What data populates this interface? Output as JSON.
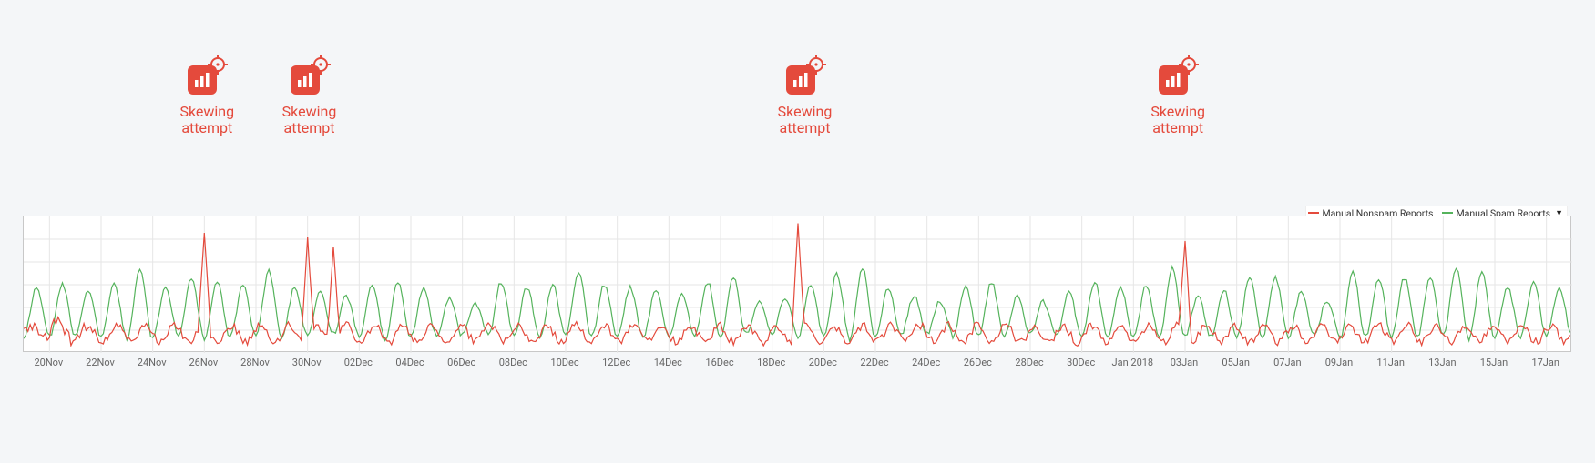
{
  "chart_data": {
    "type": "line",
    "title": "",
    "xlabel": "",
    "ylabel": "",
    "x_ticks": [
      "20Nov",
      "22Nov",
      "24Nov",
      "26Nov",
      "28Nov",
      "30Nov",
      "02Dec",
      "04Dec",
      "06Dec",
      "08Dec",
      "10Dec",
      "12Dec",
      "14Dec",
      "16Dec",
      "18Dec",
      "20Dec",
      "22Dec",
      "24Dec",
      "26Dec",
      "28Dec",
      "30Dec",
      "Jan 2018",
      "03Jan",
      "05Jan",
      "07Jan",
      "09Jan",
      "11Jan",
      "13Jan",
      "15Jan",
      "17Jan"
    ],
    "date_range": [
      "2017-11-19",
      "2018-01-18"
    ],
    "ylim_note": "relative units — y-axis not labeled in figure; values below are estimated from pixel heights (0–100)",
    "series": [
      {
        "name": "Manual Spam Reports",
        "color": "#55b35c",
        "pattern": "daily cycle, roughly one peak per day ranging ~30–65, troughs ~5–15",
        "sample_values_per_day_peak": [
          48,
          50,
          45,
          50,
          61,
          48,
          55,
          52,
          50,
          60,
          48,
          45,
          42,
          50,
          52,
          48,
          40,
          36,
          52,
          48,
          50,
          60,
          50,
          48,
          46,
          44,
          52,
          55,
          38,
          40,
          50,
          58,
          62,
          48,
          42,
          38,
          48,
          52,
          42,
          38,
          45,
          52,
          48,
          50,
          62,
          42,
          46,
          55,
          55,
          45,
          38,
          60,
          55,
          55,
          55,
          62,
          60,
          48,
          52,
          48
        ],
        "sample_values_per_day_trough": [
          12,
          12,
          12,
          12,
          10,
          12,
          12,
          10,
          12,
          12,
          12,
          12,
          14,
          12,
          10,
          12,
          12,
          14,
          12,
          12,
          12,
          12,
          12,
          12,
          12,
          12,
          12,
          12,
          14,
          14,
          12,
          12,
          10,
          12,
          14,
          14,
          12,
          12,
          12,
          14,
          12,
          12,
          12,
          12,
          10,
          12,
          12,
          12,
          12,
          12,
          14,
          10,
          12,
          12,
          12,
          12,
          10,
          12,
          12,
          12
        ]
      },
      {
        "name": "Manual Nonspam Reports",
        "color": "#e44a3c",
        "pattern": "mostly 10–25 with noise; sharp isolated spikes at the four skewing-attempt dates reaching ~80–95",
        "baseline_range": [
          8,
          28
        ],
        "spikes": [
          {
            "date": "2017-11-26",
            "approx_value": 88
          },
          {
            "date": "2017-11-30",
            "approx_value": 85
          },
          {
            "date": "2017-12-01",
            "approx_value": 78
          },
          {
            "date": "2017-12-19",
            "approx_value": 95
          },
          {
            "date": "2018-01-03",
            "approx_value": 82
          }
        ]
      }
    ],
    "legend": {
      "entries": [
        "Manual Nonspam Reports",
        "Manual Spam Reports"
      ],
      "position": "top-right",
      "has_dropdown_indicator": true
    },
    "grid": {
      "x": true,
      "y": true
    }
  },
  "annotations": [
    {
      "label_line1": "Skewing",
      "label_line2": "attempt",
      "x_frac": 0.119,
      "pair_extra_x_frac": null
    },
    {
      "label_line1": "Skewing",
      "label_line2": "attempt",
      "x_frac": 0.185,
      "pair_extra_x_frac": 0.205
    },
    {
      "label_line1": "Skewing",
      "label_line2": "attempt",
      "x_frac": 0.505,
      "pair_extra_x_frac": null
    },
    {
      "label_line1": "Skewing",
      "label_line2": "attempt",
      "x_frac": 0.746,
      "pair_extra_x_frac": null
    }
  ],
  "legend_labels": {
    "nonspam": "Manual Nonspam Reports",
    "spam": "Manual Spam Reports"
  }
}
